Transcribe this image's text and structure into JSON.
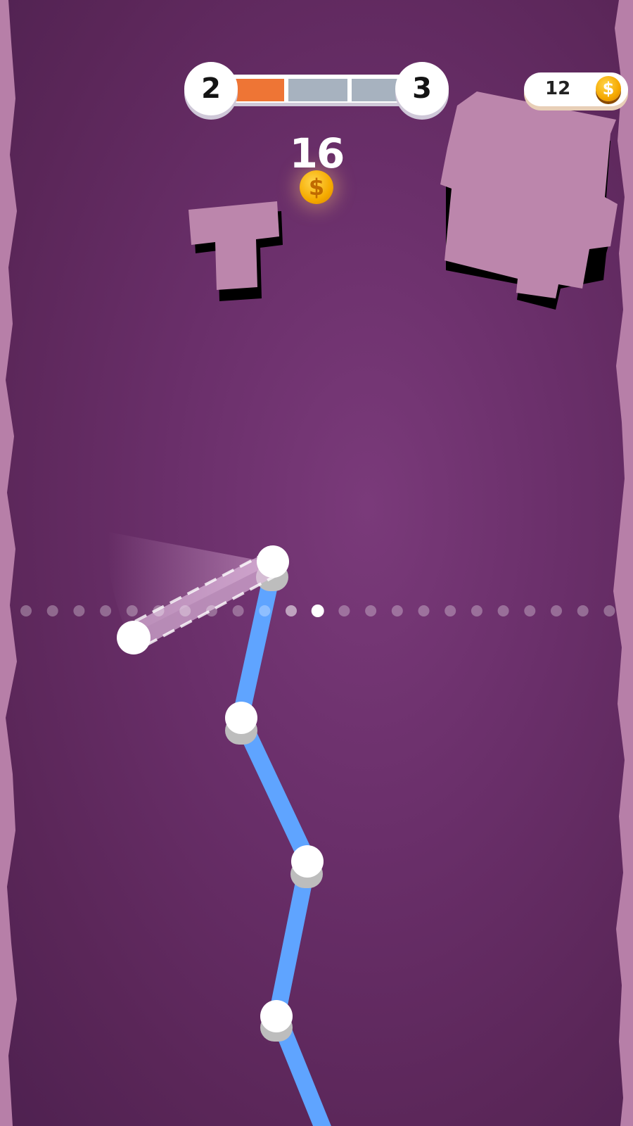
{
  "level": {
    "current": "2",
    "next": "3",
    "progress_segments_total": 3,
    "progress_segments_filled": 1,
    "fill_color": "#ee7535",
    "empty_color": "#a7b2bf"
  },
  "coins": {
    "count": "12",
    "icon": "dollar-coin-icon",
    "symbol": "$"
  },
  "reward": {
    "value": "16",
    "icon": "dollar-coin-icon",
    "symbol": "$"
  },
  "colors": {
    "background": "#6a2f6a",
    "wall": "#b77fa8",
    "block": "#bc86ac",
    "rope": "#5fa4ff",
    "node": "#ffffff"
  },
  "track": {
    "dot_count": 23,
    "active_dot": 12
  }
}
